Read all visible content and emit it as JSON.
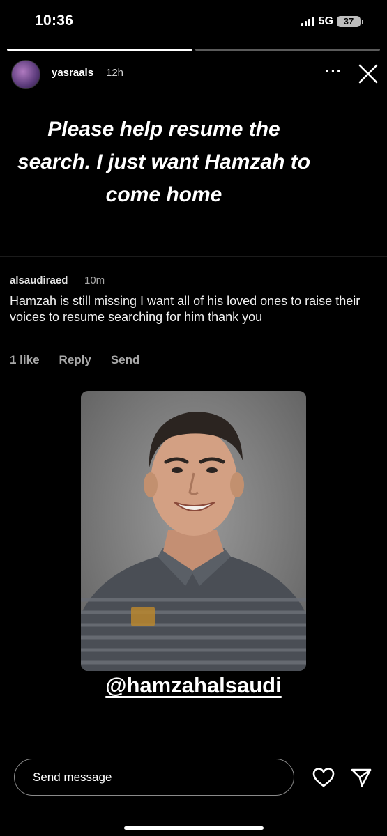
{
  "status_bar": {
    "time": "10:36",
    "network": "5G",
    "battery": "37"
  },
  "story": {
    "progress": [
      1.0,
      0.0
    ],
    "username": "yasraals",
    "time": "12h",
    "more_label": "···",
    "headline": "Please help resume the search. I just want Hamzah to come home"
  },
  "comment": {
    "username": "alsaudiraed",
    "time": "10m",
    "text": "Hamzah is still missing I want all of his loved ones to raise their voices to resume searching for him thank you",
    "actions": {
      "likes": "1 like",
      "reply": "Reply",
      "send": "Send"
    }
  },
  "mention": "@hamzahalsaudi",
  "footer": {
    "message_placeholder": "Send message"
  },
  "icons": {
    "close": "close-icon",
    "heart": "heart-icon",
    "send": "send-icon"
  },
  "colors": {
    "background": "#000000",
    "text": "#ffffff",
    "muted": "#a8a8a8"
  }
}
